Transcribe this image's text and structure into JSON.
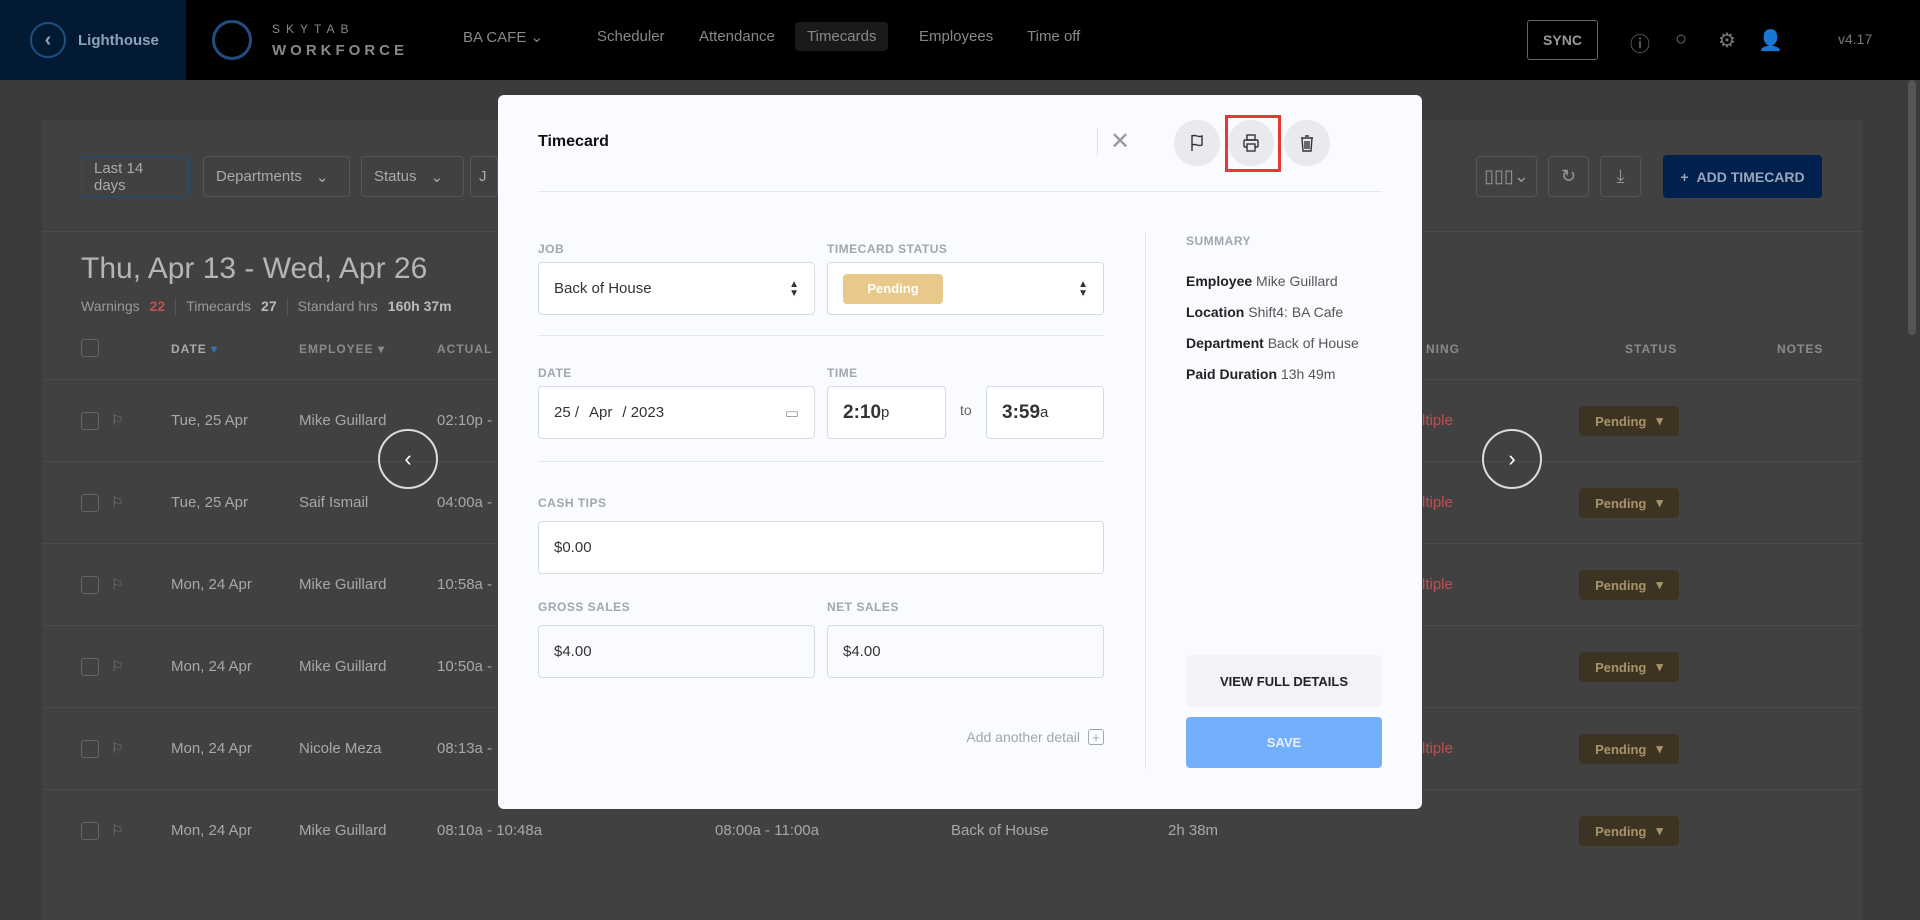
{
  "topbar": {
    "back_label": "Lighthouse",
    "logo_top": "SKYTAB",
    "logo_bottom": "WORKFORCE",
    "location": "BA CAFE",
    "nav": [
      "Scheduler",
      "Attendance",
      "Timecards",
      "Employees",
      "Time off"
    ],
    "active_nav": "Timecards",
    "sync": "SYNC",
    "version": "v4.17"
  },
  "filters": {
    "range": "Last 14 days",
    "departments": "Departments",
    "status": "Status",
    "partial": "J"
  },
  "toolbar": {
    "add_label": "ADD TIMECARD"
  },
  "content": {
    "title": "Thu, Apr 13 - Wed, Apr 26",
    "warnings_label": "Warnings",
    "warnings": "22",
    "timecards_label": "Timecards",
    "timecards": "27",
    "standard_label": "Standard hrs",
    "standard": "160h 37m"
  },
  "table": {
    "headers": {
      "date": "DATE",
      "employee": "EMPLOYEE",
      "actual": "ACTUAL",
      "warning": "NING",
      "status": "STATUS",
      "notes": "NOTES"
    },
    "rows": [
      {
        "date": "Tue, 25 Apr",
        "employee": "Mike Guillard",
        "actual": "02:10p -",
        "warning": "ltiple",
        "status": "Pending"
      },
      {
        "date": "Tue, 25 Apr",
        "employee": "Saif Ismail",
        "actual": "04:00a -",
        "warning": "ltiple",
        "status": "Pending"
      },
      {
        "date": "Mon, 24 Apr",
        "employee": "Mike Guillard",
        "actual": "10:58a -",
        "warning": "ltiple",
        "status": "Pending"
      },
      {
        "date": "Mon, 24 Apr",
        "employee": "Mike Guillard",
        "actual": "10:50a -",
        "warning": "",
        "status": "Pending"
      },
      {
        "date": "Mon, 24 Apr",
        "employee": "Nicole Meza",
        "actual": "08:13a -",
        "warning": "ltiple",
        "status": "Pending"
      },
      {
        "date": "Mon, 24 Apr",
        "employee": "Mike Guillard",
        "actual": "08:10a - 10:48a",
        "scheduled": "08:00a - 11:00a",
        "department": "Back of House",
        "total": "2h 38m",
        "warning": "",
        "status": "Pending"
      }
    ]
  },
  "modal": {
    "title": "Timecard",
    "job_label": "JOB",
    "job_value": "Back of House",
    "status_label": "TIMECARD STATUS",
    "status_value": "Pending",
    "date_label": "DATE",
    "date_day": "25 /",
    "date_month": "Apr",
    "date_year": "/ 2023",
    "time_label": "TIME",
    "start_time": "2:10",
    "start_suffix": "p",
    "to": "to",
    "end_time": "3:59",
    "end_suffix": "a",
    "cash_tips_label": "CASH TIPS",
    "cash_tips": "$0.00",
    "gross_label": "GROSS SALES",
    "gross": "$4.00",
    "net_label": "NET SALES",
    "net": "$4.00",
    "add_detail": "Add another detail",
    "summary_label": "SUMMARY",
    "summary": [
      {
        "k": "Employee",
        "v": "Mike Guillard"
      },
      {
        "k": "Location",
        "v": "Shift4: BA Cafe"
      },
      {
        "k": "Department",
        "v": "Back of House"
      },
      {
        "k": "Paid Duration",
        "v": "13h 49m"
      }
    ],
    "view_full": "VIEW FULL DETAILS",
    "save": "SAVE"
  },
  "colors": {
    "accent": "#0047b8",
    "pending": "#e8c98a",
    "warning": "#c0392b",
    "save": "#74affc",
    "highlight": "#e53935"
  }
}
